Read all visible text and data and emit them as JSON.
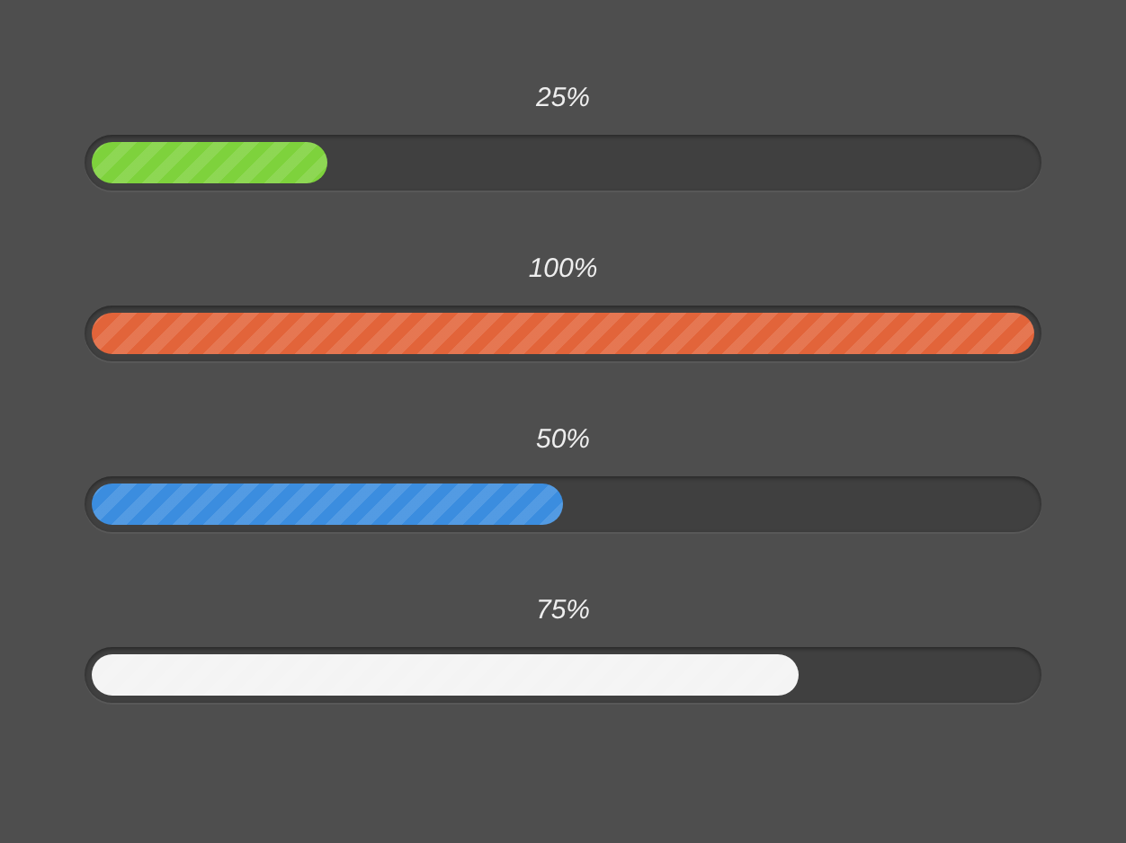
{
  "bars": [
    {
      "label": "25%",
      "level": 0.25,
      "color": "#7ed23c"
    },
    {
      "label": "100%",
      "level": 1,
      "color": "#e2643a"
    },
    {
      "label": "50%",
      "level": 0.5,
      "color": "#3b8ddf"
    },
    {
      "label": "75%",
      "level": 0.75,
      "color": "#f4f4f4"
    }
  ]
}
